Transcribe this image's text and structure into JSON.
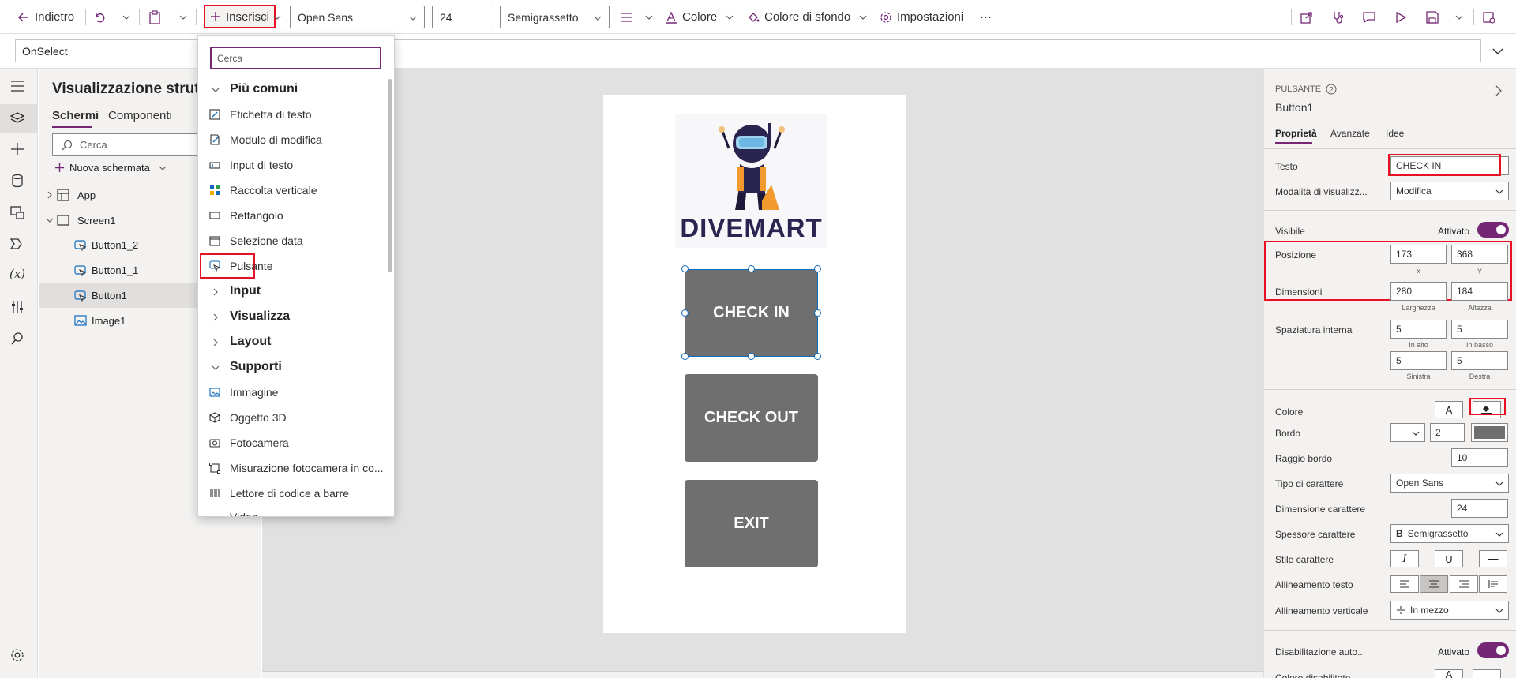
{
  "toolbar": {
    "back": "Indietro",
    "insert": "Inserisci",
    "font": "Open Sans",
    "font_size": "24",
    "font_weight": "Semigrassetto",
    "color": "Colore",
    "bg_color": "Colore di sfondo",
    "settings": "Impostazioni",
    "more": "···"
  },
  "formula": {
    "property": "OnSelect"
  },
  "tree": {
    "title": "Visualizzazione struttura ad albero",
    "tabs": [
      "Schermi",
      "Componenti"
    ],
    "search_placeholder": "Cerca",
    "new_screen": "Nuova schermata",
    "items": [
      "App",
      "Screen1",
      "Button1_2",
      "Button1_1",
      "Button1",
      "Image1"
    ]
  },
  "insert_menu": {
    "search_placeholder": "Cerca",
    "groups": {
      "common": "Più comuni",
      "input": "Input",
      "display": "Visualizza",
      "layout": "Layout",
      "media": "Supporti"
    },
    "common_items": [
      "Etichetta di testo",
      "Modulo di modifica",
      "Input di testo",
      "Raccolta verticale",
      "Rettangolo",
      "Selezione data",
      "Pulsante"
    ],
    "media_items": [
      "Immagine",
      "Oggetto 3D",
      "Fotocamera",
      "Misurazione fotocamera in co...",
      "Lettore di codice a barre",
      "Video"
    ]
  },
  "canvas": {
    "logo_text": "DIVEMART",
    "buttons": [
      "CHECK IN",
      "CHECK OUT",
      "EXIT"
    ]
  },
  "properties": {
    "type": "PULSANTE",
    "name": "Button1",
    "tabs": [
      "Proprietà",
      "Avanzate",
      "Idee"
    ],
    "text_label": "Testo",
    "text_value": "CHECK IN",
    "display_mode_label": "Modalità di visualizz...",
    "display_mode_value": "Modifica",
    "visible_label": "Visibile",
    "visible_value": "Attivato",
    "position_label": "Posizione",
    "position_x": "173",
    "position_y": "368",
    "x_caption": "X",
    "y_caption": "Y",
    "size_label": "Dimensioni",
    "width": "280",
    "height": "184",
    "width_caption": "Larghezza",
    "height_caption": "Altezza",
    "padding_label": "Spaziatura interna",
    "pad_top": "5",
    "pad_bottom": "5",
    "pad_left": "5",
    "pad_right": "5",
    "pad_top_caption": "In alto",
    "pad_bottom_caption": "In basso",
    "pad_left_caption": "Sinistra",
    "pad_right_caption": "Destra",
    "color_label": "Colore",
    "color_text_glyph": "A",
    "border_label": "Bordo",
    "border_width": "2",
    "radius_label": "Raggio bordo",
    "radius_value": "10",
    "font_label": "Tipo di carattere",
    "font_value": "Open Sans",
    "font_size_label": "Dimensione carattere",
    "font_size_value": "24",
    "font_weight_label": "Spessore carattere",
    "font_weight_value": "Semigrassetto",
    "font_weight_glyph": "B",
    "font_style_label": "Stile carattere",
    "italic_glyph": "I",
    "underline_glyph": "U",
    "strike_glyph": "—",
    "text_align_label": "Allineamento testo",
    "vertical_align_label": "Allineamento verticale",
    "vertical_align_value": "In mezzo",
    "auto_disable_label": "Disabilitazione auto...",
    "auto_disable_value": "Attivato",
    "disabled_color_label": "Colore disabilitato",
    "disabled_color_glyph": "A"
  },
  "colors": {
    "accent": "#742774",
    "highlight_red": "#e81123",
    "button_gray": "#6f6f6f",
    "selection_blue": "#0f6cbd"
  }
}
